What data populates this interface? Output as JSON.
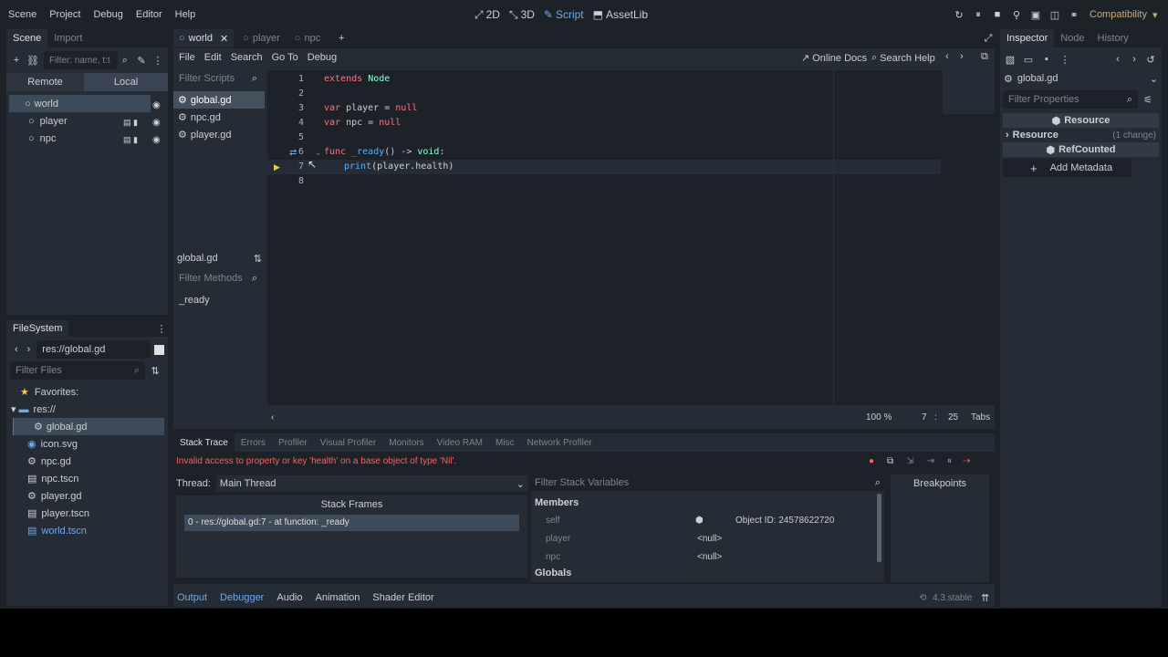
{
  "menu": [
    "Scene",
    "Project",
    "Debug",
    "Editor",
    "Help"
  ],
  "workspaces": [
    "2D",
    "3D",
    "Script",
    "AssetLib"
  ],
  "renderer": "Compatibility",
  "left_dock": {
    "tabs": [
      "Scene",
      "Import"
    ],
    "filter_placeholder": "Filter: name, t:t",
    "remote_label": "Remote",
    "local_label": "Local",
    "nodes": [
      "world",
      "player",
      "npc"
    ]
  },
  "filesystem": {
    "title": "FileSystem",
    "path": "res://global.gd",
    "filter_placeholder": "Filter Files",
    "favorites": "Favorites:",
    "root": "res://",
    "files": [
      "global.gd",
      "icon.svg",
      "npc.gd",
      "npc.tscn",
      "player.gd",
      "player.tscn",
      "world.tscn"
    ]
  },
  "scene_tabs": [
    "world",
    "player",
    "npc"
  ],
  "script_menu": [
    "File",
    "Edit",
    "Search",
    "Go To",
    "Debug"
  ],
  "online_docs": "Online Docs",
  "search_help": "Search Help",
  "scripts_panel": {
    "filter_placeholder": "Filter Scripts",
    "scripts": [
      "global.gd",
      "npc.gd",
      "player.gd"
    ],
    "current": "global.gd",
    "methods_placeholder": "Filter Methods",
    "methods": [
      "_ready"
    ]
  },
  "code": {
    "line_numbers": [
      "1",
      "2",
      "3",
      "4",
      "5",
      "6",
      "7",
      "8"
    ],
    "l1_kw": "extends",
    "l1_ty": "Node",
    "l3_kw": "var",
    "l3_name": " player = ",
    "l3_null": "null",
    "l4_kw": "var",
    "l4_name": " npc = ",
    "l4_null": "null",
    "l6_kw": "func",
    "l6_fn": " _ready",
    "l6_rest": "() -> ",
    "l6_ty": "void",
    "l6_colon": ":",
    "l7_fn": "print",
    "l7_rest": "(player.health)"
  },
  "status": {
    "zoom": "100 %",
    "line": "7",
    "col": "25",
    "indent": "Tabs"
  },
  "debugger": {
    "tabs": [
      "Stack Trace",
      "Errors",
      "Profiler",
      "Visual Profiler",
      "Monitors",
      "Video RAM",
      "Misc",
      "Network Profiler"
    ],
    "error": "Invalid access to property or key 'health' on a base object of type 'Nil'.",
    "thread_label": "Thread:",
    "thread_value": "Main Thread",
    "stack_frames_header": "Stack Frames",
    "frame": "0 - res://global.gd:7 - at function: _ready",
    "filter_vars_placeholder": "Filter Stack Variables",
    "members_header": "Members",
    "vars": [
      {
        "name": "self",
        "value": "Object ID: 24578622720"
      },
      {
        "name": "player",
        "value": "<null>"
      },
      {
        "name": "npc",
        "value": "<null>"
      }
    ],
    "globals_header": "Globals",
    "breakpoints": "Breakpoints"
  },
  "bottom_tabs": [
    "Output",
    "Debugger",
    "Audio",
    "Animation",
    "Shader Editor"
  ],
  "version": "4.3.stable",
  "inspector": {
    "tabs": [
      "Inspector",
      "Node",
      "History"
    ],
    "resource_path": "global.gd",
    "filter_placeholder": "Filter Properties",
    "section_resource": "Resource",
    "group_resource": "Resource",
    "group_change": "(1 change)",
    "section_refcounted": "RefCounted",
    "add_metadata": "Add Metadata"
  },
  "colors": {
    "accent": "#6fa8e8",
    "error": "#ff5d5d",
    "selection": "#3d4a5a"
  }
}
